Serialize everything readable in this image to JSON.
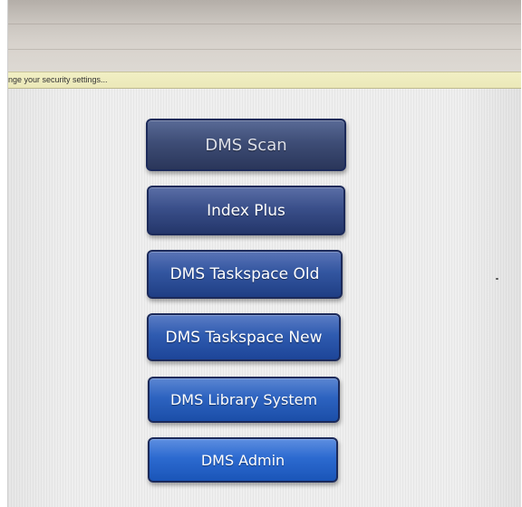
{
  "info_bar": {
    "text": "nge your security settings..."
  },
  "menu": {
    "buttons": [
      {
        "label": "DMS Scan"
      },
      {
        "label": "Index Plus"
      },
      {
        "label": "DMS Taskspace Old"
      },
      {
        "label": "DMS Taskspace New"
      },
      {
        "label": "DMS Library System"
      },
      {
        "label": "DMS Admin"
      }
    ]
  }
}
